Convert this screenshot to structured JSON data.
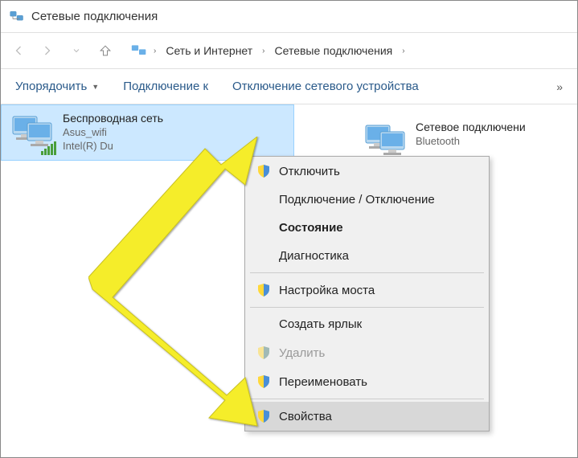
{
  "window": {
    "title": "Сетевые подключения"
  },
  "breadcrumb": {
    "item1": "Сеть и Интернет",
    "item2": "Сетевые подключения"
  },
  "toolbar": {
    "organize": "Упорядочить",
    "connect": "Подключение к",
    "disable": "Отключение сетевого устройства",
    "more": "»"
  },
  "connections": {
    "wifi": {
      "name": "Беспроводная сеть",
      "ssid": "Asus_wifi",
      "adapter": "Intel(R) Du"
    },
    "bluetooth": {
      "name": "Сетевое подключени",
      "sub": "Bluetooth"
    }
  },
  "context_menu": {
    "disable": "Отключить",
    "toggle": "Подключение / Отключение",
    "status": "Состояние",
    "diagnostic": "Диагностика",
    "bridge": "Настройка моста",
    "shortcut": "Создать ярлык",
    "delete": "Удалить",
    "rename": "Переименовать",
    "properties": "Свойства"
  }
}
